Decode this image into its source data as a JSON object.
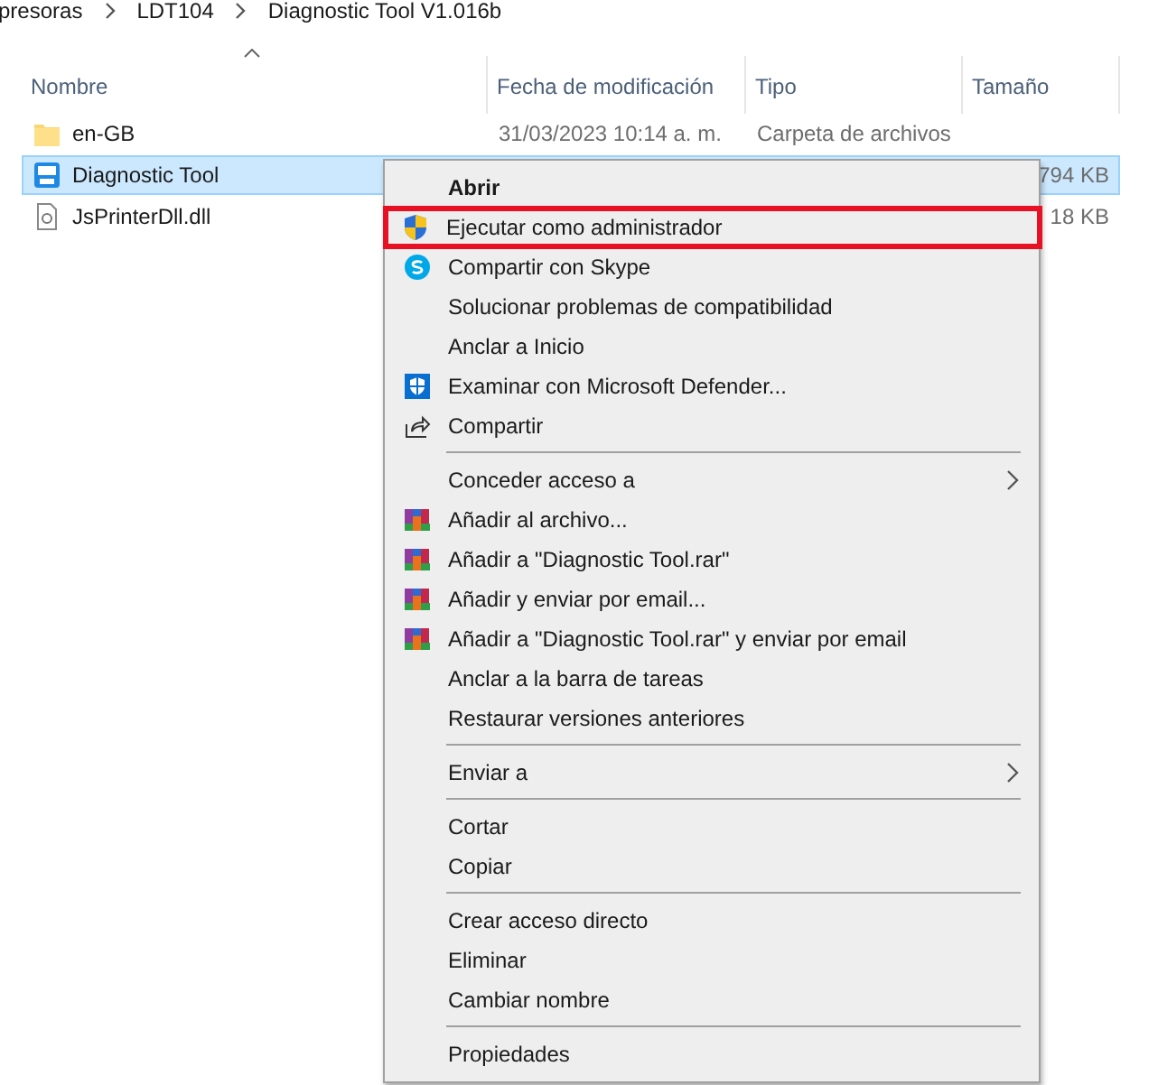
{
  "breadcrumb": [
    "presoras",
    "LDT104",
    "Diagnostic Tool V1.016b"
  ],
  "columns": [
    {
      "label": "Nombre",
      "sorted": true
    },
    {
      "label": "Fecha de modificación",
      "sorted": false
    },
    {
      "label": "Tipo",
      "sorted": false
    },
    {
      "label": "Tamaño",
      "sorted": false
    }
  ],
  "rows": [
    {
      "kind": "folder",
      "name": "en-GB",
      "date": "31/03/2023 10:14 a. m.",
      "type": "Carpeta de archivos",
      "selected": false
    },
    {
      "kind": "application",
      "name": "Diagnostic Tool",
      "size": "794 KB",
      "selected": true
    },
    {
      "kind": "library",
      "name": "JsPrinterDll.dll",
      "size": "18 KB",
      "selected": false
    }
  ],
  "context_menu": [
    {
      "kind": "plain",
      "label": "Abrir",
      "default": true
    },
    {
      "kind": "admin",
      "label": "Ejecutar como administrador",
      "highlighted": true
    },
    {
      "kind": "skype",
      "label": "Compartir con Skype"
    },
    {
      "kind": "plain",
      "label": "Solucionar problemas de compatibilidad"
    },
    {
      "kind": "plain",
      "label": "Anclar a Inicio"
    },
    {
      "kind": "defender",
      "label": "Examinar con Microsoft Defender..."
    },
    {
      "kind": "share",
      "label": "Compartir"
    },
    {
      "kind": "separator"
    },
    {
      "kind": "plain",
      "label": "Conceder acceso a",
      "submenu": true
    },
    {
      "kind": "archive",
      "label": "Añadir al archivo..."
    },
    {
      "kind": "archive",
      "label": "Añadir a \"Diagnostic Tool.rar\""
    },
    {
      "kind": "archive",
      "label": "Añadir y enviar por email..."
    },
    {
      "kind": "archive",
      "label": "Añadir a \"Diagnostic Tool.rar\" y enviar por email"
    },
    {
      "kind": "plain",
      "label": "Anclar a la barra de tareas"
    },
    {
      "kind": "plain",
      "label": "Restaurar versiones anteriores"
    },
    {
      "kind": "separator"
    },
    {
      "kind": "plain",
      "label": "Enviar a",
      "submenu": true
    },
    {
      "kind": "separator"
    },
    {
      "kind": "plain",
      "label": "Cortar"
    },
    {
      "kind": "plain",
      "label": "Copiar"
    },
    {
      "kind": "separator"
    },
    {
      "kind": "plain",
      "label": "Crear acceso directo"
    },
    {
      "kind": "plain",
      "label": "Eliminar"
    },
    {
      "kind": "plain",
      "label": "Cambiar nombre"
    },
    {
      "kind": "separator"
    },
    {
      "kind": "plain",
      "label": "Propiedades"
    }
  ]
}
